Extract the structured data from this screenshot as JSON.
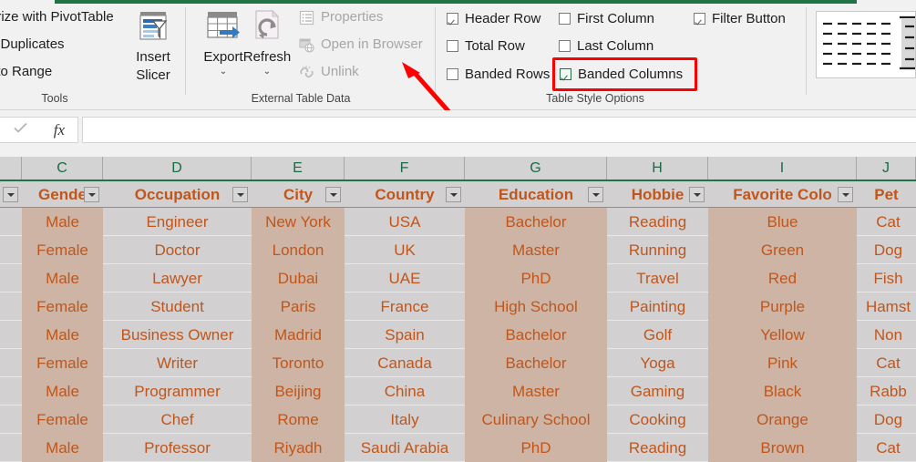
{
  "ribbon": {
    "tools_group": {
      "title": "Tools",
      "commands": [
        "arize with PivotTable",
        "e Duplicates",
        "t to Range"
      ],
      "insert_slicer": {
        "label_line1": "Insert",
        "label_line2": "Slicer",
        "icon": "slicer-icon"
      }
    },
    "external_table_data_group": {
      "title": "External Table Data",
      "export": {
        "label": "Export",
        "caret": "⌄",
        "icon": "export-table-icon"
      },
      "refresh": {
        "label": "Refresh",
        "caret": "⌄",
        "icon": "refresh-icon"
      },
      "small_commands": [
        {
          "label": "Properties",
          "icon": "properties-icon",
          "disabled": true
        },
        {
          "label": "Open in Browser",
          "icon": "open-in-browser-icon",
          "disabled": true
        },
        {
          "label": "Unlink",
          "icon": "unlink-icon",
          "disabled": true
        }
      ]
    },
    "table_style_options_group": {
      "title": "Table Style Options",
      "options": [
        {
          "label": "Header Row",
          "checked": true,
          "highlighted": false
        },
        {
          "label": "First Column",
          "checked": false,
          "highlighted": false
        },
        {
          "label": "Filter Button",
          "checked": true,
          "highlighted": false
        },
        {
          "label": "Total Row",
          "checked": false,
          "highlighted": false
        },
        {
          "label": "Last Column",
          "checked": false,
          "highlighted": false
        },
        {
          "label": "Banded Rows",
          "checked": false,
          "highlighted": false
        },
        {
          "label": "Banded Columns",
          "checked": true,
          "highlighted": true
        }
      ]
    },
    "table_styles_gallery": {
      "name": "table-styles-gallery"
    },
    "annotation": {
      "type": "red-arrow",
      "points_to": "Banded Rows",
      "color": "#ff0000"
    },
    "highlight": {
      "type": "red-rectangle",
      "around": "Banded Columns",
      "color": "#ff0000"
    }
  },
  "formula_bar": {
    "confirm_icon": "checkmark-icon",
    "function_icon": "fx-icon",
    "value": "",
    "placeholder": ""
  },
  "colors": {
    "ribbon_accent": "#217346",
    "table_text": "#c0561b",
    "band_column_a": "#cdb4a4",
    "band_column_b": "#d2d0d0",
    "header_fill": "#d3d3d3",
    "header_underline": "#d4783c",
    "col_letter": "#1a6b45"
  },
  "sheet": {
    "column_letters": [
      "",
      "C",
      "D",
      "E",
      "F",
      "G",
      "H",
      "I",
      "J"
    ],
    "headers": [
      "",
      "Gende",
      "Occupation",
      "City",
      "Country",
      "Education",
      "Hobbie",
      "Favorite Colo",
      "Pet"
    ],
    "rows": [
      [
        "",
        "Male",
        "Engineer",
        "New York",
        "USA",
        "Bachelor",
        "Reading",
        "Blue",
        "Cat"
      ],
      [
        "",
        "Female",
        "Doctor",
        "London",
        "UK",
        "Master",
        "Running",
        "Green",
        "Dog"
      ],
      [
        "",
        "Male",
        "Lawyer",
        "Dubai",
        "UAE",
        "PhD",
        "Travel",
        "Red",
        "Fish"
      ],
      [
        "",
        "Female",
        "Student",
        "Paris",
        "France",
        "High School",
        "Painting",
        "Purple",
        "Hamst"
      ],
      [
        "",
        "Male",
        "Business Owner",
        "Madrid",
        "Spain",
        "Bachelor",
        "Golf",
        "Yellow",
        "Non"
      ],
      [
        "",
        "Female",
        "Writer",
        "Toronto",
        "Canada",
        "Bachelor",
        "Yoga",
        "Pink",
        "Cat"
      ],
      [
        "",
        "Male",
        "Programmer",
        "Beijing",
        "China",
        "Master",
        "Gaming",
        "Black",
        "Rabb"
      ],
      [
        "",
        "Female",
        "Chef",
        "Rome",
        "Italy",
        "Culinary School",
        "Cooking",
        "Orange",
        "Dog"
      ],
      [
        "",
        "Male",
        "Professor",
        "Riyadh",
        "Saudi Arabia",
        "PhD",
        "Reading",
        "Brown",
        "Cat"
      ]
    ],
    "filter_buttons": [
      "filter-dropdown-b",
      "filter-dropdown-c",
      "filter-dropdown-d",
      "filter-dropdown-e",
      "filter-dropdown-f",
      "filter-dropdown-g",
      "filter-dropdown-h",
      "filter-dropdown-i"
    ]
  }
}
